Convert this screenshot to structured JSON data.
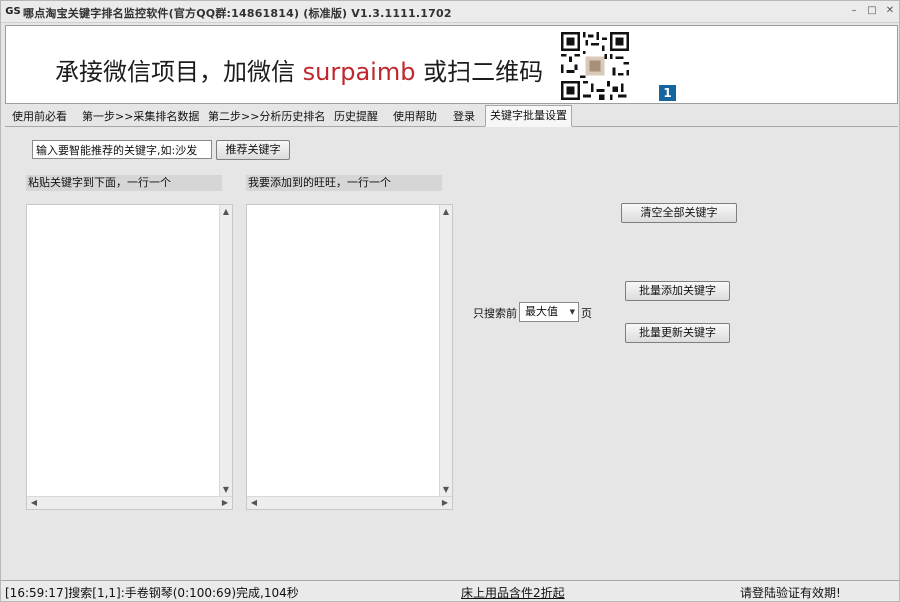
{
  "window": {
    "icon_text": "GS",
    "title": "哪点淘宝关键字排名监控软件(官方QQ群:14861814) (标准版) V1.3.1111.1702",
    "min_glyph": "–",
    "max_glyph": "□",
    "close_glyph": "✕"
  },
  "banner": {
    "text_before": "承接微信项目，加微信 ",
    "wechat_id": "surpaimb",
    "text_after": " 或扫二维码",
    "badge": "1"
  },
  "tabs": [
    {
      "label": "使用前必看",
      "active": false
    },
    {
      "label": "第一步>>采集排名数据",
      "active": false
    },
    {
      "label": "第二步>>分析历史排名",
      "active": false
    },
    {
      "label": "历史提醒",
      "active": false
    },
    {
      "label": "使用帮助",
      "active": false
    },
    {
      "label": "登录",
      "active": false
    },
    {
      "label": "关键字批量设置",
      "active": true
    }
  ],
  "keyword_input": {
    "value": "输入要智能推荐的关键字,如:沙发"
  },
  "buttons": {
    "recommend": "推荐关键字",
    "clear_all": "清空全部关键字",
    "batch_add": "批量添加关键字",
    "batch_update": "批量更新关键字"
  },
  "lists": {
    "left_label": "粘贴关键字到下面，一行一个",
    "right_label": "我要添加到的旺旺，一行一个"
  },
  "search_limit": {
    "prefix": "只搜索前",
    "selected": "最大值",
    "suffix": "页"
  },
  "statusbar": {
    "status": "[16:59:17]搜索[1,1]:手卷钢琴(0:100:69)完成,104秒",
    "promo_link": "床上用品含件2折起",
    "notice": "请登陆验证有效期!"
  }
}
